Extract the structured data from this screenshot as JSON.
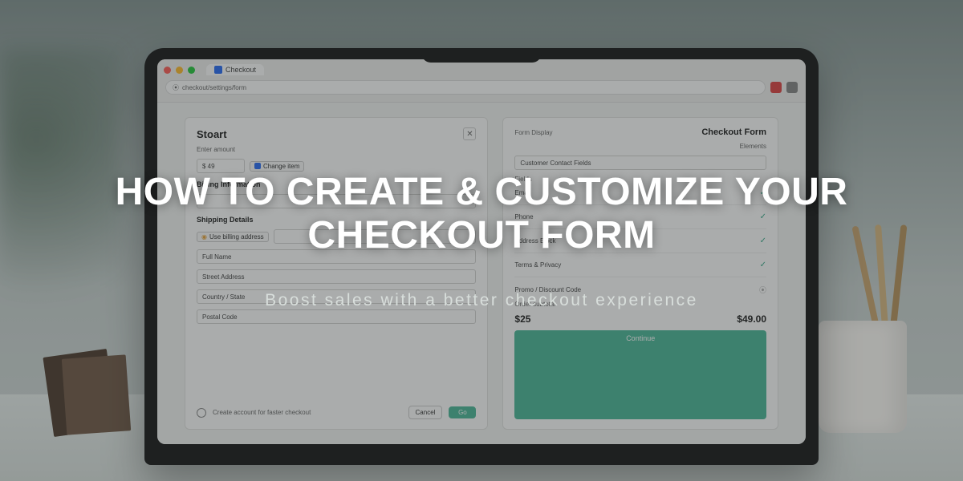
{
  "headline": {
    "title": "HOW TO CREATE & CUSTOMIZE YOUR CHECKOUT FORM",
    "subtitle": "Boost sales with a better checkout experience"
  },
  "browser": {
    "tab_label": "Checkout",
    "url": "checkout/settings/form"
  },
  "left_panel": {
    "title": "Stoart",
    "amount_label": "Enter amount",
    "amount_value": "$ 49",
    "change_chip": "Change item",
    "section1": "Billing Information",
    "section2": "Shipping Details",
    "chip2": "Use billing address",
    "field1": "Full Name",
    "field2": "Street Address",
    "field3": "Country / State",
    "field4": "Postal Code",
    "radio_label": "Create account for faster checkout",
    "btn_cancel": "Cancel",
    "btn_next": "Go"
  },
  "right_panel": {
    "title": "Checkout Form",
    "subtitle_a": "Form Display",
    "subtitle_b": "Elements",
    "opt1": "Customer Contact Fields",
    "opt_group1": "Fields",
    "opt2": "Email",
    "opt3": "Phone",
    "opt4": "Address Block",
    "opt5": "Terms & Privacy",
    "opt6": "Promo / Discount Code",
    "summary_label": "Order subtotal",
    "summary_left": "$25",
    "summary_right": "$49.00",
    "btn": "Continue"
  }
}
